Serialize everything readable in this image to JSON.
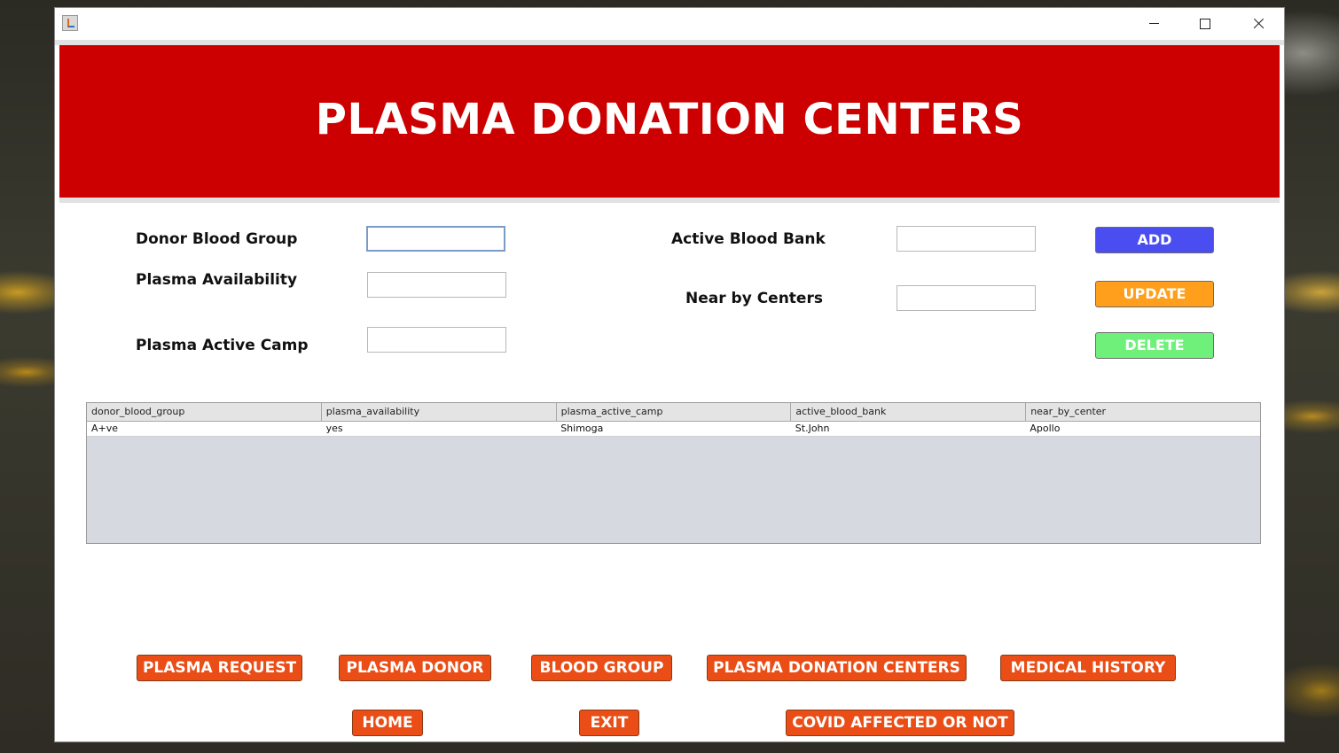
{
  "banner": {
    "title": "PLASMA DONATION CENTERS"
  },
  "form": {
    "donor_blood_group_label": "Donor Blood Group",
    "plasma_availability_label": "Plasma Availability",
    "plasma_active_camp_label": "Plasma Active Camp",
    "active_blood_bank_label": "Active Blood Bank",
    "near_by_centers_label": "Near by Centers",
    "donor_blood_group_value": "",
    "plasma_availability_value": "",
    "plasma_active_camp_value": "",
    "active_blood_bank_value": "",
    "near_by_centers_value": ""
  },
  "actions": {
    "add": "ADD",
    "update": "UPDATE",
    "delete": "DELETE"
  },
  "colors": {
    "banner": "#cc0000",
    "add": "#4a4ef0",
    "update": "#ff9f1c",
    "delete": "#6ef07a",
    "nav": "#ea4d15"
  },
  "table": {
    "columns": [
      "donor_blood_group",
      "plasma_availability",
      "plasma_active_camp",
      "active_blood_bank",
      "near_by_center"
    ],
    "rows": [
      [
        "A+ve",
        "yes",
        "Shimoga",
        "St.John",
        "Apollo"
      ]
    ]
  },
  "nav": {
    "plasma_request": "PLASMA REQUEST",
    "plasma_donor": "PLASMA DONOR",
    "blood_group": "BLOOD GROUP",
    "plasma_donation_centers": "PLASMA DONATION CENTERS",
    "medical_history": "MEDICAL HISTORY",
    "home": "HOME",
    "exit": "EXIT",
    "covid_affected": "COVID AFFECTED OR NOT"
  }
}
